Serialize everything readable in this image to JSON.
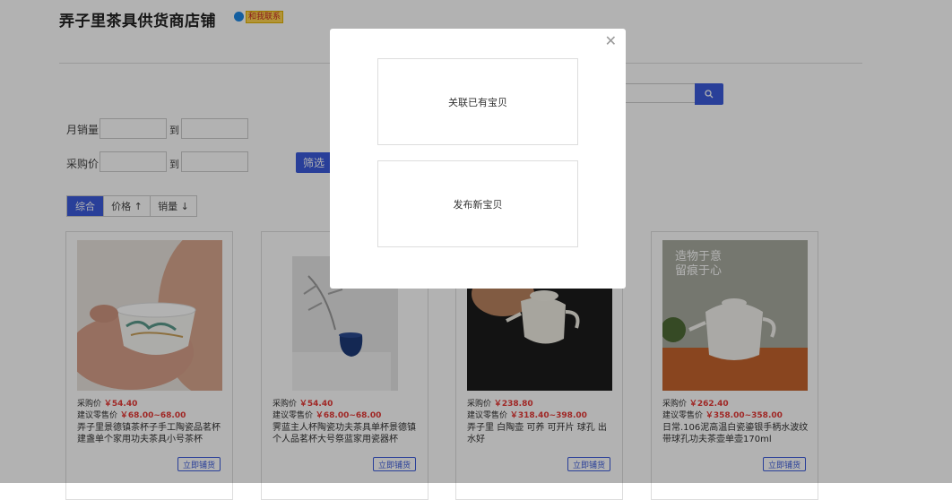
{
  "shop": {
    "title": "弄子里茶具供货商店铺",
    "contact_label": "和我联系"
  },
  "filters": {
    "monthly_sales_label": "月销量",
    "purchase_price_label": "采购价",
    "to_label": "到",
    "filter_button": "筛选"
  },
  "sort": {
    "options": [
      "综合",
      "价格 ↑",
      "销量 ↓"
    ],
    "active": "综合"
  },
  "products": [
    {
      "purchase_label": "采购价",
      "purchase_price": "￥54.40",
      "retail_label": "建议零售价",
      "retail_price": "￥68.00~68.00",
      "title": "弄子里景德镇茶杯子手工陶瓷品茗杯建盏单个家用功夫茶具小号茶杯",
      "button": "立即铺货"
    },
    {
      "purchase_label": "采购价",
      "purchase_price": "￥54.40",
      "retail_label": "建议零售价",
      "retail_price": "￥68.00~68.00",
      "title": "霁蓝主人杯陶瓷功夫茶具单杯景德镇个人品茗杯大号祭蓝家用瓷器杯",
      "button": "立即铺货"
    },
    {
      "purchase_label": "采购价",
      "purchase_price": "￥238.80",
      "retail_label": "建议零售价",
      "retail_price": "￥318.40~398.00",
      "title": "弄子里 白陶壶 可养 可开片 球孔 出水好",
      "button": "立即铺货"
    },
    {
      "purchase_label": "采购价",
      "purchase_price": "￥262.40",
      "retail_label": "建议零售价",
      "retail_price": "￥358.00~358.00",
      "title": "日常.106泥高温白瓷鎏银手柄水波纹带球孔功夫茶壶单壶170ml",
      "button": "立即铺货",
      "image_text": [
        "造物于意",
        "留痕于心"
      ]
    }
  ],
  "modal": {
    "option1": "关联已有宝贝",
    "option2": "发布新宝贝"
  }
}
